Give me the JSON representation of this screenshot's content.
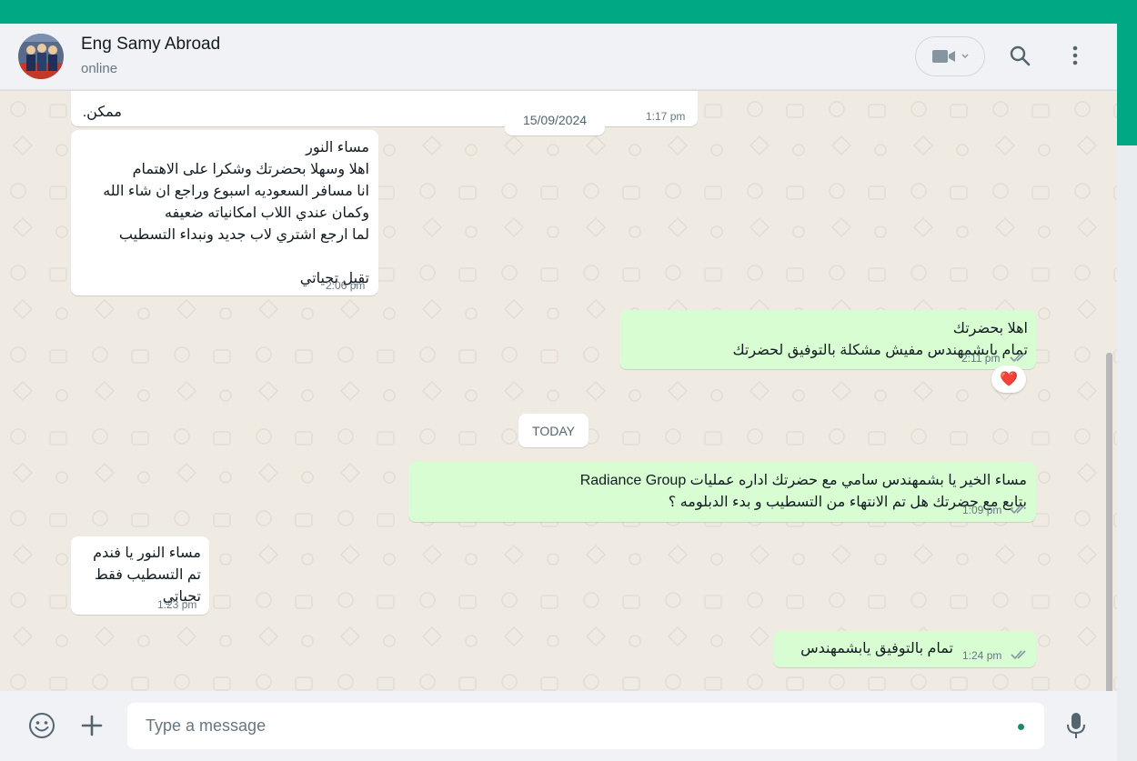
{
  "header": {
    "contact_name": "Eng Samy Abroad",
    "status": "online"
  },
  "messages": [
    {
      "direction": "in",
      "text": "ممكن.",
      "time": "1:17 pm"
    },
    {
      "direction": "in",
      "text": "مساء النور\nاهلا وسهلا بحضرتك  وشكرا على الاهتمام\nانا مسافر السعوديه اسبوع وراجع ان شاء الله\nوكمان عندي اللاب امكانياته ضعيفه\nلما ارجع اشتري لاب جديد ونبداء التسطيب\n\nتقبل تحياتي",
      "time": "2:06 pm"
    },
    {
      "direction": "out",
      "text": "اهلا بحضرتك\nتمام يابشمهندس مفيش مشكلة بالتوفيق لحضرتك",
      "time": "2:11 pm",
      "reaction": "❤️"
    },
    {
      "direction": "out",
      "text": "مساء الخير يا بشمهندس سامي مع  حضرتك اداره عمليات Radiance Group\nبتابع مع حضرتك هل تم الانتهاء من التسطيب و بدء الدبلومه ؟",
      "time": "1:09 pm"
    },
    {
      "direction": "in",
      "text": "مساء النور يا فندم\nتم التسطيب فقط\nتحياتي",
      "time": "1:23 pm"
    },
    {
      "direction": "out",
      "text": "تمام بالتوفيق يابشمهندس",
      "time": "1:24 pm"
    }
  ],
  "date_separators": [
    "15/09/2024",
    "TODAY"
  ],
  "composer": {
    "placeholder": "Type a message"
  },
  "colors": {
    "accent": "#00a884",
    "outgoing_bubble": "#d9fdd3",
    "incoming_bubble": "#ffffff",
    "chat_background": "#efeae2",
    "read_tick": "#8696a0"
  },
  "icons": {
    "video": "video-call-icon",
    "search": "search-icon",
    "menu": "menu-dots-icon",
    "emoji": "emoji-icon",
    "attach": "plus-icon",
    "mic": "microphone-icon"
  }
}
